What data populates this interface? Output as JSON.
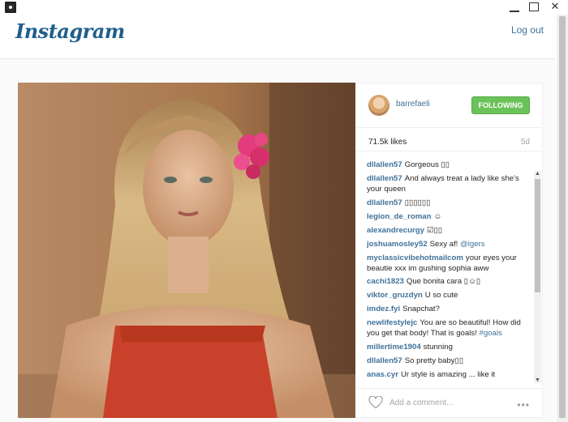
{
  "window": {
    "controls": [
      "minimize",
      "maximize",
      "close"
    ],
    "close_glyph": "✕"
  },
  "header": {
    "logo": "Instagram",
    "logout": "Log out"
  },
  "post": {
    "username": "barrefaeli",
    "follow_label": "FOLLOWING",
    "likes": "71.5k likes",
    "age": "5d",
    "comments": [
      {
        "user": "dllallen57",
        "text": "Gorgeous ▯▯"
      },
      {
        "user": "dllallen57",
        "text": "And always treat a lady like she's your queen"
      },
      {
        "user": "dllallen57",
        "text": "▯▯▯▯▯▯"
      },
      {
        "user": "legion_de_roman",
        "text": "☺"
      },
      {
        "user": "alexandrecurgy",
        "text": "☑▯▯"
      },
      {
        "user": "joshuamosley52",
        "text": "Sexy af! ",
        "tag": "@lgers"
      },
      {
        "user": "myclassicvibehotmailcom",
        "text": "your eyes your beautie xxx im gushing sophia aww"
      },
      {
        "user": "cachi1823",
        "text": "Que bonita cara ▯☺▯"
      },
      {
        "user": "viktor_gruzdyn",
        "text": "U so cute"
      },
      {
        "user": "imdez.fyi",
        "text": "Snapchat?"
      },
      {
        "user": "newlifestylejc",
        "text": "You are so beautiful! How did you get that body! That is goals! ",
        "tag": "#goals"
      },
      {
        "user": "millertime1904",
        "text": "stunning"
      },
      {
        "user": "dllallen57",
        "text": "So pretty baby▯▯"
      },
      {
        "user": "anas.cyr",
        "text": "Ur style is amazing ... like it"
      }
    ],
    "add_comment_placeholder": "Add a comment...",
    "more_label": "•••"
  },
  "colors": {
    "link": "#3f729b",
    "follow_green": "#6bc259",
    "logo": "#1f5f8c"
  },
  "icons": {
    "like": "heart-icon",
    "more": "ellipsis-icon",
    "app": "app-icon"
  }
}
